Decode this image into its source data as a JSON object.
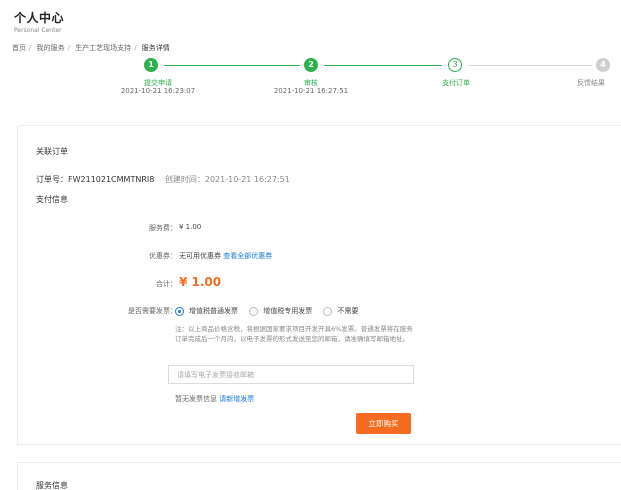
{
  "header": {
    "title": "个人中心",
    "subtitle": "Personal Center"
  },
  "breadcrumb": [
    "首页",
    "我的服务",
    "生产工艺现场支持",
    "服务详情"
  ],
  "steps": [
    {
      "number": "1",
      "label": "提交申请",
      "time": "2021-10-21 16:23:07",
      "state": "done"
    },
    {
      "number": "2",
      "label": "审核",
      "time": "2021-10-21 16:27:51",
      "state": "done"
    },
    {
      "number": "3",
      "label": "支付订单",
      "time": "",
      "state": "active"
    },
    {
      "number": "4",
      "label": "反馈结果",
      "time": "",
      "state": "pending"
    }
  ],
  "order": {
    "section_title": "关联订单",
    "order_no_label": "订单号：",
    "order_no": "FW211021CMMTNRI8",
    "created_label": "创建时间：",
    "created_time": "2021-10-21 16:27:51",
    "pay_section_title": "支付信息",
    "fee_label": "服务费：",
    "fee_value": "¥ 1.00",
    "coupon_label": "优惠券：",
    "coupon_value": "无可用优惠券",
    "coupon_link": "查看全部优惠券",
    "total_label": "合计：",
    "total_value": "¥ 1.00",
    "invoice_label": "是否需要发票：",
    "invoice_options": [
      "增值税普通发票",
      "增值税专用发票",
      "不需要"
    ],
    "invoice_selected": "增值税普通发票",
    "invoice_note": "注：以上商品价格含税，将根据国家要求项目开发开具6%发票。普通发票将在服务订单完成后一个月内，以电子发票的形式发送至您的邮箱，请准确填写邮箱地址。",
    "email_placeholder": "请填写电子发票接收邮箱",
    "no_invoice_text": "暂无发票信息",
    "add_invoice_link": "请新增发票",
    "buy_button": "立即购买"
  },
  "service_section_title": "服务信息",
  "colors": {
    "green": "#2bb24c",
    "orange": "#f36c21",
    "blue": "#1e7ae0"
  }
}
